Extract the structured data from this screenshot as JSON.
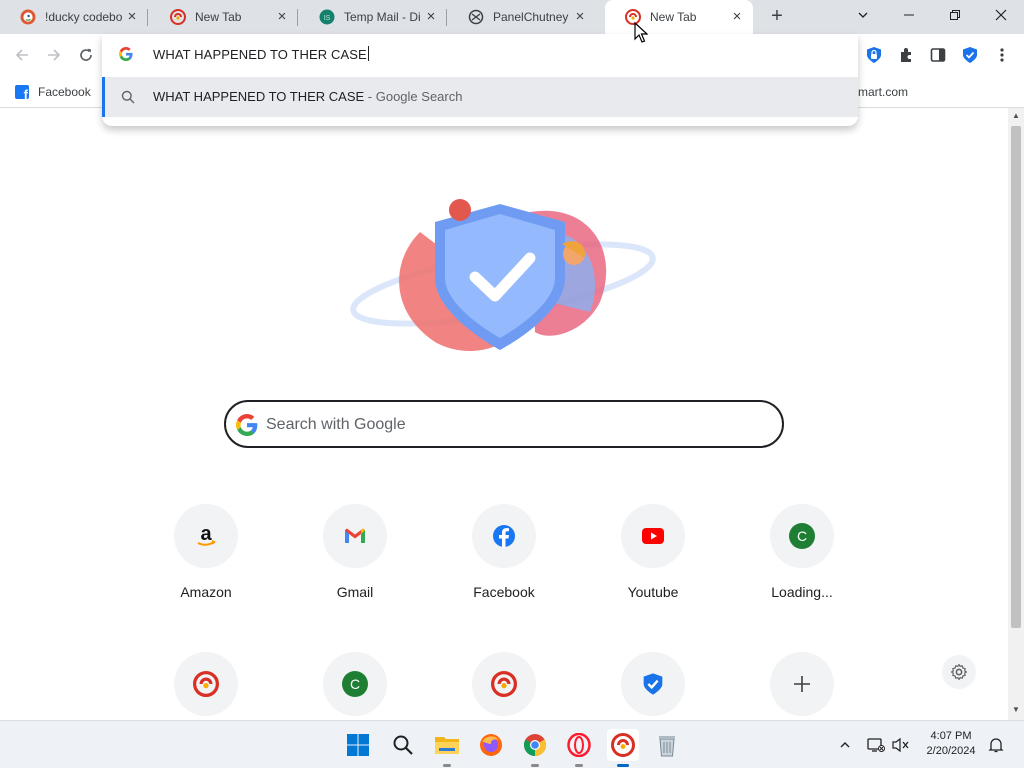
{
  "tabs": [
    {
      "title": "!ducky codebo",
      "icon": "duckduckgo-icon"
    },
    {
      "title": "New Tab",
      "icon": "vpn-shield-icon"
    },
    {
      "title": "Temp Mail - Di",
      "icon": "tempmail-icon"
    },
    {
      "title": "PanelChutney",
      "icon": "panelchutney-icon"
    },
    {
      "title": "New Tab",
      "icon": "vpn-shield-icon"
    }
  ],
  "active_tab_index": 4,
  "omnibox": {
    "text": "WHAT HAPPENED TO THER CASE",
    "suggestion_query": "WHAT HAPPENED TO THER CASE",
    "suggestion_suffix": " - Google Search"
  },
  "bookmarks": {
    "facebook": "Facebook",
    "walmart_partial": "mart.com"
  },
  "search": {
    "placeholder": "Search with Google"
  },
  "shortcuts": [
    {
      "label": "Amazon",
      "icon": "amazon-icon"
    },
    {
      "label": "Gmail",
      "icon": "gmail-icon"
    },
    {
      "label": "Facebook",
      "icon": "facebook-icon"
    },
    {
      "label": "Youtube",
      "icon": "youtube-icon"
    },
    {
      "label": "Loading...",
      "icon": "letter-c-icon",
      "letter": "C"
    }
  ],
  "shortcuts_row2": [
    {
      "icon": "vpn-shield-icon"
    },
    {
      "icon": "letter-c-icon",
      "letter": "C"
    },
    {
      "icon": "vpn-shield-icon"
    },
    {
      "icon": "shield-check-icon"
    },
    {
      "icon": "plus-icon"
    }
  ],
  "clock": {
    "time": "4:07 PM",
    "date": "2/20/2024"
  },
  "colors": {
    "accent": "#1a73e8",
    "tab_strip": "#dee1e6",
    "suggestion_bg": "#e8eaed"
  }
}
